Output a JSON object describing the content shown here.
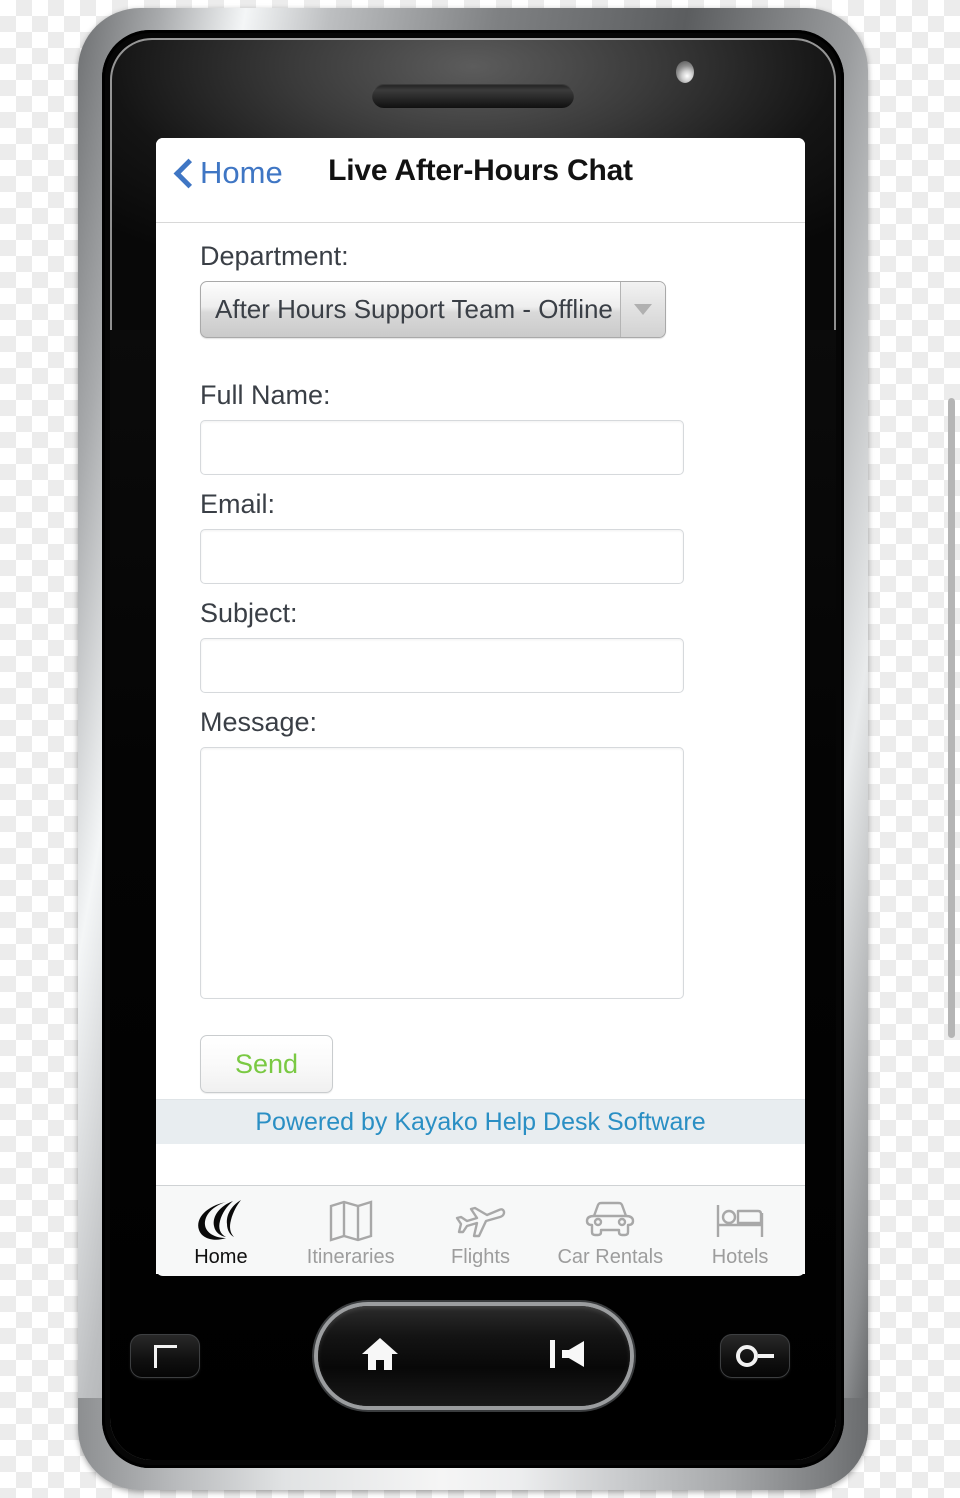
{
  "device": {
    "name": "smartphone-mockup",
    "earpiece": "earpiece-speaker",
    "camera": "front-camera-icon",
    "hardware_buttons": [
      {
        "name": "menu-button",
        "icon": "corner-bracket-icon"
      },
      {
        "name": "home-button",
        "icon": "home-icon"
      },
      {
        "name": "back-button",
        "icon": "back-arrow-icon"
      },
      {
        "name": "search-button",
        "icon": "key-icon"
      }
    ]
  },
  "nav": {
    "back_label": "Home",
    "back_icon": "chevron-left-icon",
    "title": "Live After-Hours Chat",
    "link_color": "#3f76c4"
  },
  "form": {
    "department": {
      "label": "Department:",
      "selected": "After Hours Support Team - Offline",
      "arrow_icon": "chevron-down-icon"
    },
    "fields": [
      {
        "name": "full-name",
        "label": "Full Name:",
        "value": "",
        "placeholder": ""
      },
      {
        "name": "email",
        "label": "Email:",
        "value": "",
        "placeholder": ""
      },
      {
        "name": "subject",
        "label": "Subject:",
        "value": "",
        "placeholder": ""
      }
    ],
    "message": {
      "label": "Message:",
      "value": "",
      "placeholder": ""
    },
    "send_label": "Send",
    "send_color": "#7ac943"
  },
  "footer": {
    "powered_text": "Powered by Kayako Help Desk Software",
    "link_color": "#2a8fc4",
    "band_color": "#e8edf0"
  },
  "tabs": [
    {
      "label": "Home",
      "icon": "swoosh-logo-icon",
      "active": true
    },
    {
      "label": "Itineraries",
      "icon": "map-icon",
      "active": false
    },
    {
      "label": "Flights",
      "icon": "airplane-icon",
      "active": false
    },
    {
      "label": "Car Rentals",
      "icon": "car-icon",
      "active": false
    },
    {
      "label": "Hotels",
      "icon": "bed-icon",
      "active": false
    }
  ]
}
